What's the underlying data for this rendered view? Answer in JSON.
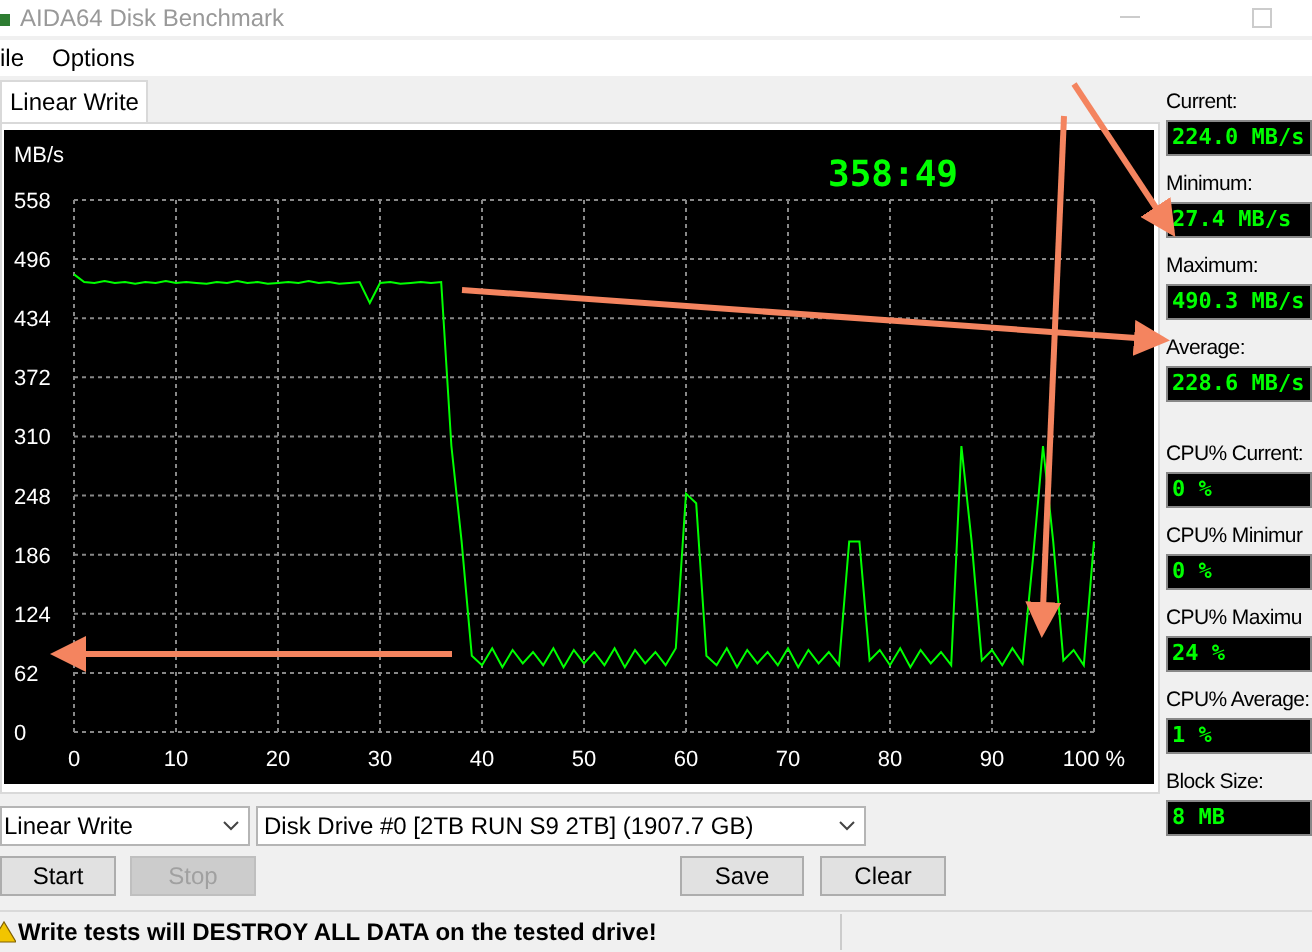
{
  "window": {
    "title": "AIDA64 Disk Benchmark"
  },
  "menu": [
    "ile",
    "Options"
  ],
  "tabs": [
    {
      "label": "Linear Write",
      "selected": true
    }
  ],
  "chart": {
    "timer": "358:49",
    "chart_data": {
      "type": "line",
      "ylabel": "MB/s",
      "x": [
        0,
        1,
        2,
        3,
        4,
        5,
        6,
        7,
        8,
        9,
        10,
        11,
        12,
        13,
        14,
        15,
        16,
        17,
        18,
        19,
        20,
        21,
        22,
        23,
        24,
        25,
        26,
        27,
        28,
        29,
        30,
        31,
        32,
        33,
        34,
        35,
        36,
        37,
        38,
        39,
        40,
        41,
        42,
        43,
        44,
        45,
        46,
        47,
        48,
        49,
        50,
        51,
        52,
        53,
        54,
        55,
        56,
        57,
        58,
        59,
        60,
        61,
        62,
        63,
        64,
        65,
        66,
        67,
        68,
        69,
        70,
        71,
        72,
        73,
        74,
        75,
        76,
        77,
        78,
        79,
        80,
        81,
        82,
        83,
        84,
        85,
        86,
        87,
        88,
        89,
        90,
        91,
        92,
        93,
        94,
        95,
        96,
        97,
        98,
        99,
        100
      ],
      "grid": true,
      "series": [
        {
          "color": "#00ff00",
          "values": [
            480,
            472,
            471,
            473,
            471,
            472,
            470,
            472,
            471,
            473,
            471,
            472,
            471,
            470,
            472,
            471,
            473,
            471,
            472,
            470,
            471,
            472,
            471,
            473,
            471,
            472,
            470,
            471,
            472,
            450,
            471,
            472,
            470,
            471,
            472,
            471,
            472,
            300,
            200,
            80,
            70,
            88,
            68,
            86,
            72,
            84,
            70,
            88,
            68,
            86,
            72,
            84,
            70,
            88,
            68,
            86,
            72,
            84,
            70,
            88,
            250,
            240,
            80,
            70,
            88,
            68,
            86,
            72,
            84,
            70,
            88,
            68,
            86,
            72,
            84,
            70,
            200,
            200,
            75,
            86,
            70,
            88,
            68,
            86,
            72,
            84,
            70,
            300,
            200,
            75,
            86,
            70,
            88,
            72,
            180,
            300,
            200,
            75,
            86,
            70,
            200
          ]
        }
      ],
      "xlim": [
        0,
        100
      ],
      "ylim": [
        0,
        558
      ],
      "xticks": [
        0,
        10,
        20,
        30,
        40,
        50,
        60,
        70,
        80,
        90,
        {
          "value": 100,
          "label": "100 %"
        }
      ],
      "yticks": [
        0,
        62,
        124,
        186,
        248,
        310,
        372,
        434,
        496,
        558
      ]
    }
  },
  "stats": [
    {
      "label": "Current:",
      "value": "224.0 MB/s"
    },
    {
      "label": "Minimum:",
      "value": "27.4 MB/s"
    },
    {
      "label": "Maximum:",
      "value": "490.3 MB/s"
    },
    {
      "label": "Average:",
      "value": "228.6 MB/s"
    },
    {
      "label": "CPU% Current:",
      "value": "0 %"
    },
    {
      "label": "CPU% Minimur",
      "value": "0 %"
    },
    {
      "label": "CPU% Maximu",
      "value": "24 %"
    },
    {
      "label": "CPU% Average:",
      "value": "1 %"
    },
    {
      "label": "Block Size:",
      "value": "8 MB"
    }
  ],
  "test_select": {
    "value": "Linear Write"
  },
  "drive_select": {
    "value": "Disk Drive #0  [2TB RUN S9 2TB]  (1907.7 GB)"
  },
  "buttons": [
    {
      "label": "Start",
      "disabled": false
    },
    {
      "label": "Stop",
      "disabled": true
    },
    {
      "label": "Save",
      "disabled": false
    },
    {
      "label": "Clear",
      "disabled": false
    }
  ],
  "status_bar": {
    "message": "Write tests will DESTROY ALL DATA on the tested drive!"
  }
}
